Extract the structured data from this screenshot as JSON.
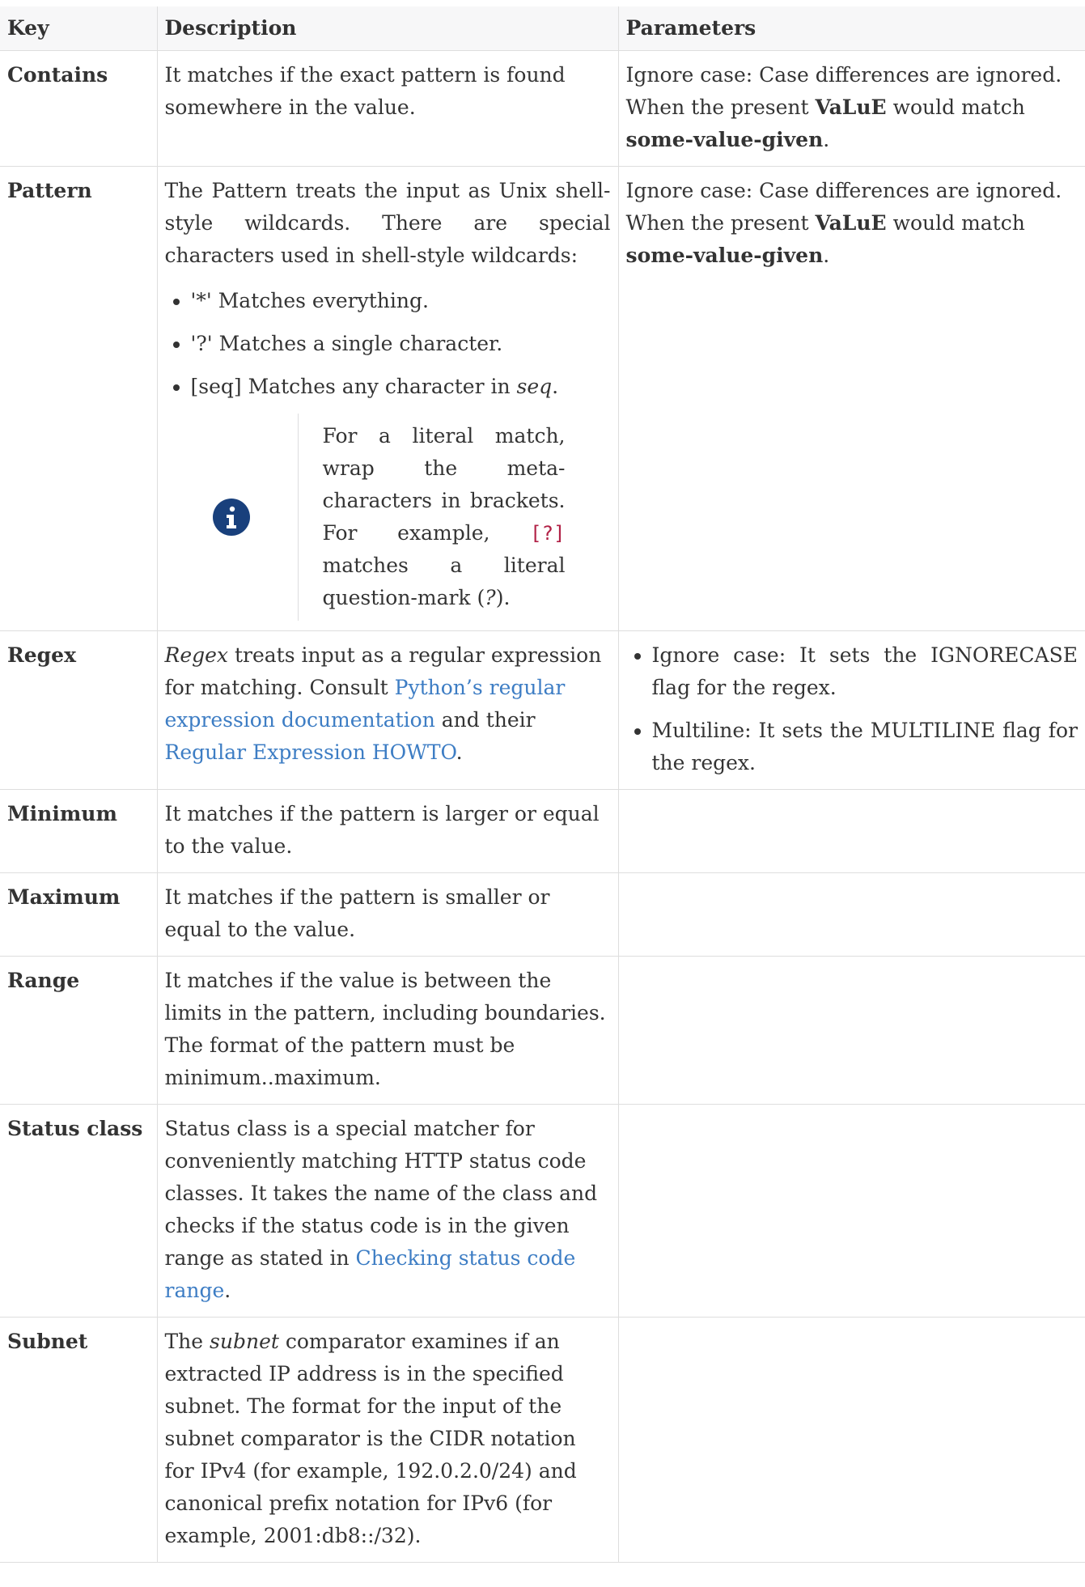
{
  "header": {
    "key": "Key",
    "description": "Description",
    "parameters": "Parameters"
  },
  "rows": {
    "contains": {
      "key": "Contains",
      "desc": "It matches if the exact pattern is found somewhere in the value.",
      "p1": "Ignore case: Case differences are ignored. When the present ",
      "p_bold1": "VaLuE",
      "p2": " would match ",
      "p_bold2": "some-value-given",
      "p3": "."
    },
    "pattern": {
      "key": "Pattern",
      "desc": "The Pattern treats the input as Unix shell-style wildcards. There are special characters used in shell-style wildcards:",
      "bullets": [
        "'*' Matches everything.",
        "'?' Matches a single character.",
        "[seq] Matches any character in "
      ],
      "seq": "seq",
      "period": ".",
      "note1": "For a literal match, wrap the meta-characters in brackets. For example, ",
      "note_code": "[?]",
      "note2": " matches a literal question-mark (",
      "note_q": "?",
      "note3": ").",
      "p1": "Ignore case: Case differences are ignored. When the present ",
      "p_bold1": "VaLuE",
      "p2": " would match ",
      "p_bold2": "some-value-given",
      "p3": "."
    },
    "regex": {
      "key": "Regex",
      "desc_em": "Regex",
      "desc1": " treats input as a regular expression for matching. Consult ",
      "link1": "Python’s regular expression documentation",
      "desc2": " and their ",
      "link2": "Regular Expression HOWTO",
      "desc3": ".",
      "params": [
        "Ignore case: It sets the IGNORECASE flag for the regex.",
        "Multiline: It sets the MULTILINE flag for the regex."
      ]
    },
    "minimum": {
      "key": "Minimum",
      "desc": "It matches if the pattern is larger or equal to the value."
    },
    "maximum": {
      "key": "Maximum",
      "desc": "It matches if the pattern is smaller or equal to the value."
    },
    "range": {
      "key": "Range",
      "desc": "It matches if the value is between the limits in the pattern, including boundaries. The format of the pattern must be minimum..maximum."
    },
    "status": {
      "key": "Status class",
      "desc1": "Status class is a special matcher for conveniently matching HTTP status code classes. It takes the name of the class and checks if the status code is in the given range as stated in ",
      "link": "Checking status code range",
      "desc2": "."
    },
    "subnet": {
      "key": "Subnet",
      "desc0": "The ",
      "desc_em": "subnet",
      "desc1": " comparator examines if an extracted IP address is in the specified subnet. The format for the input of the subnet comparator is the CIDR notation for IPv4 (for example, 192.0.2.0/24) and canonical prefix notation for IPv6 (for example, 2001:db8::/32)."
    }
  },
  "icons": {
    "note": "info-icon"
  },
  "colors": {
    "link": "#3d7dc4",
    "code": "#b12146",
    "icon": "#19407c",
    "header_bg": "#f7f7f8"
  }
}
